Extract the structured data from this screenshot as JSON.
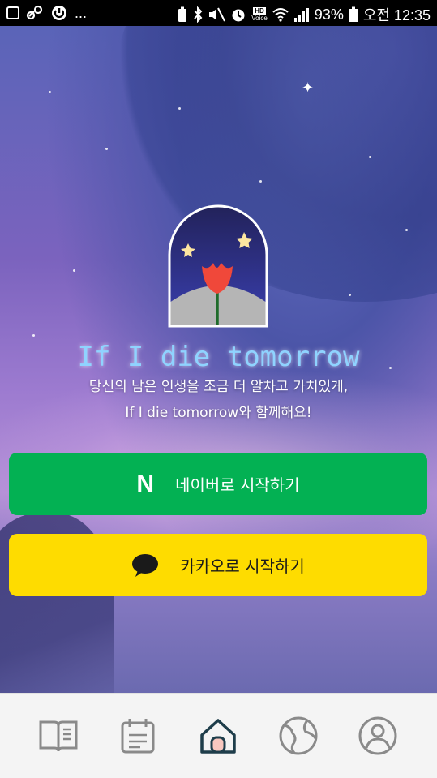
{
  "status_bar": {
    "battery": "93%",
    "time": "오전 12:35",
    "hd_label": "HD",
    "voice_label": "Voice",
    "dots": "..."
  },
  "app": {
    "title": "If I die tomorrow",
    "tagline_line1": "당신의 남은 인생을 조금 더 알차고 가치있게,",
    "tagline_line2": "If I die tomorrow와 함께해요!"
  },
  "buttons": {
    "naver_icon_letter": "N",
    "naver_label": "네이버로 시작하기",
    "kakao_label": "카카오로 시작하기"
  },
  "colors": {
    "naver_green": "#03b153",
    "kakao_yellow": "#fedc00",
    "nav_inactive": "#8a8a8a",
    "nav_active": "#1e3d4a",
    "title_blue": "#8fd3ff"
  },
  "bottom_nav": {
    "items": [
      {
        "icon": "book-icon",
        "active": false
      },
      {
        "icon": "calendar-icon",
        "active": false
      },
      {
        "icon": "home-icon",
        "active": true
      },
      {
        "icon": "globe-icon",
        "active": false
      },
      {
        "icon": "profile-icon",
        "active": false
      }
    ]
  }
}
